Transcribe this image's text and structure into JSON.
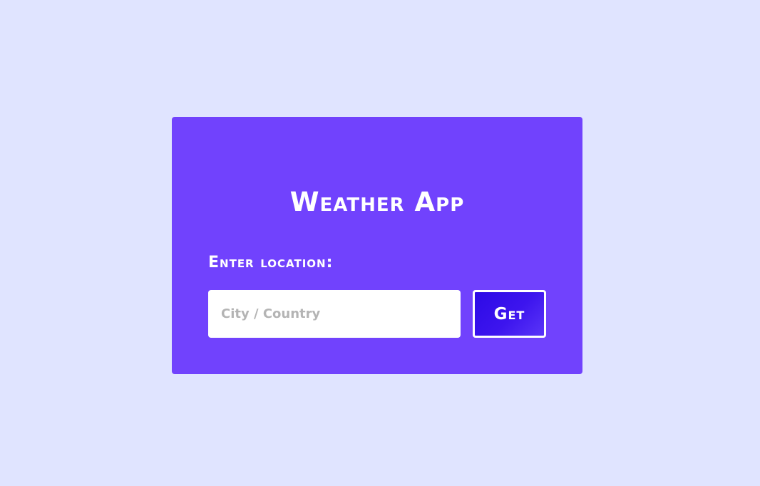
{
  "app": {
    "title": "Weather App"
  },
  "form": {
    "label": "Enter location:",
    "input_value": "",
    "input_placeholder": "City / Country",
    "submit_label": "Get"
  },
  "colors": {
    "page_background": "#e0e4ff",
    "card_background": "#7142fd",
    "button_background": "#2d0ae6",
    "text": "#ffffff",
    "placeholder": "#b4b4b4"
  }
}
